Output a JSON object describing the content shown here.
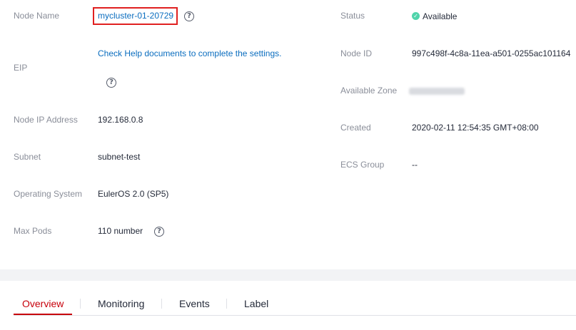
{
  "left_fields": {
    "node_name": {
      "label": "Node Name",
      "value": "mycluster-01-20729"
    },
    "eip": {
      "label": "EIP",
      "link": "Check Help documents to complete the settings."
    },
    "node_ip": {
      "label": "Node IP Address",
      "value": "192.168.0.8"
    },
    "subnet": {
      "label": "Subnet",
      "value": "subnet-test"
    },
    "os": {
      "label": "Operating System",
      "value": "EulerOS 2.0 (SP5)"
    },
    "max_pods": {
      "label": "Max Pods",
      "value": "110 number"
    }
  },
  "right_fields": {
    "status": {
      "label": "Status",
      "value": "Available"
    },
    "node_id": {
      "label": "Node ID",
      "value": "997c498f-4c8a-11ea-a501-0255ac101164"
    },
    "az": {
      "label": "Available Zone",
      "value": ""
    },
    "created": {
      "label": "Created",
      "value": "2020-02-11 12:54:35 GMT+08:00"
    },
    "ecs_group": {
      "label": "ECS Group",
      "value": "--"
    }
  },
  "help_glyph": "?",
  "status_glyph": "✓",
  "tabs": [
    {
      "label": "Overview",
      "active": true
    },
    {
      "label": "Monitoring",
      "active": false
    },
    {
      "label": "Events",
      "active": false
    },
    {
      "label": "Label",
      "active": false
    }
  ],
  "colors": {
    "link": "#0a6dbf",
    "highlight_box": "#e02020",
    "status_available": "#50d4ab",
    "active_tab": "#c7000b"
  }
}
